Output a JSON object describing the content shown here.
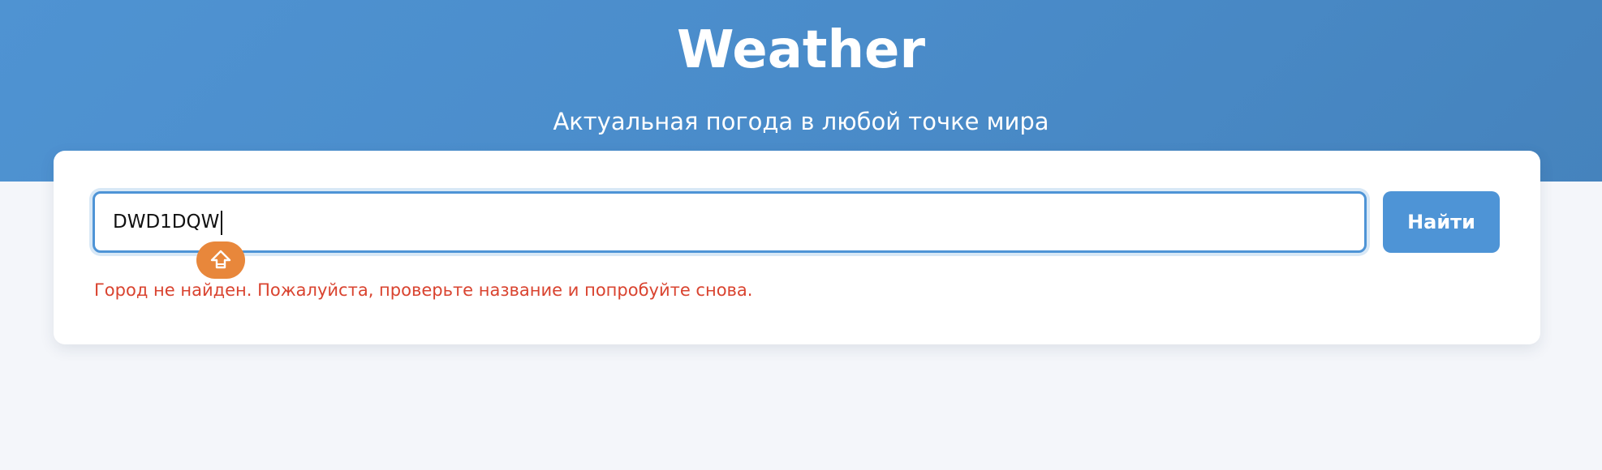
{
  "header": {
    "title": "Weather",
    "subtitle": "Актуальная погода в любой точке мира"
  },
  "search": {
    "value": "DWD1DQW",
    "placeholder": "",
    "button_label": "Найти",
    "error_message": "Город не найден. Пожалуйста, проверьте название и попробуйте снова."
  },
  "overlay": {
    "badge_icon": "shift-arrow-icon"
  },
  "colors": {
    "header_blue": "#4a8cca",
    "accent": "#4e94d6",
    "error": "#d9432f",
    "badge": "#e8873b",
    "background": "#f4f6fa"
  }
}
